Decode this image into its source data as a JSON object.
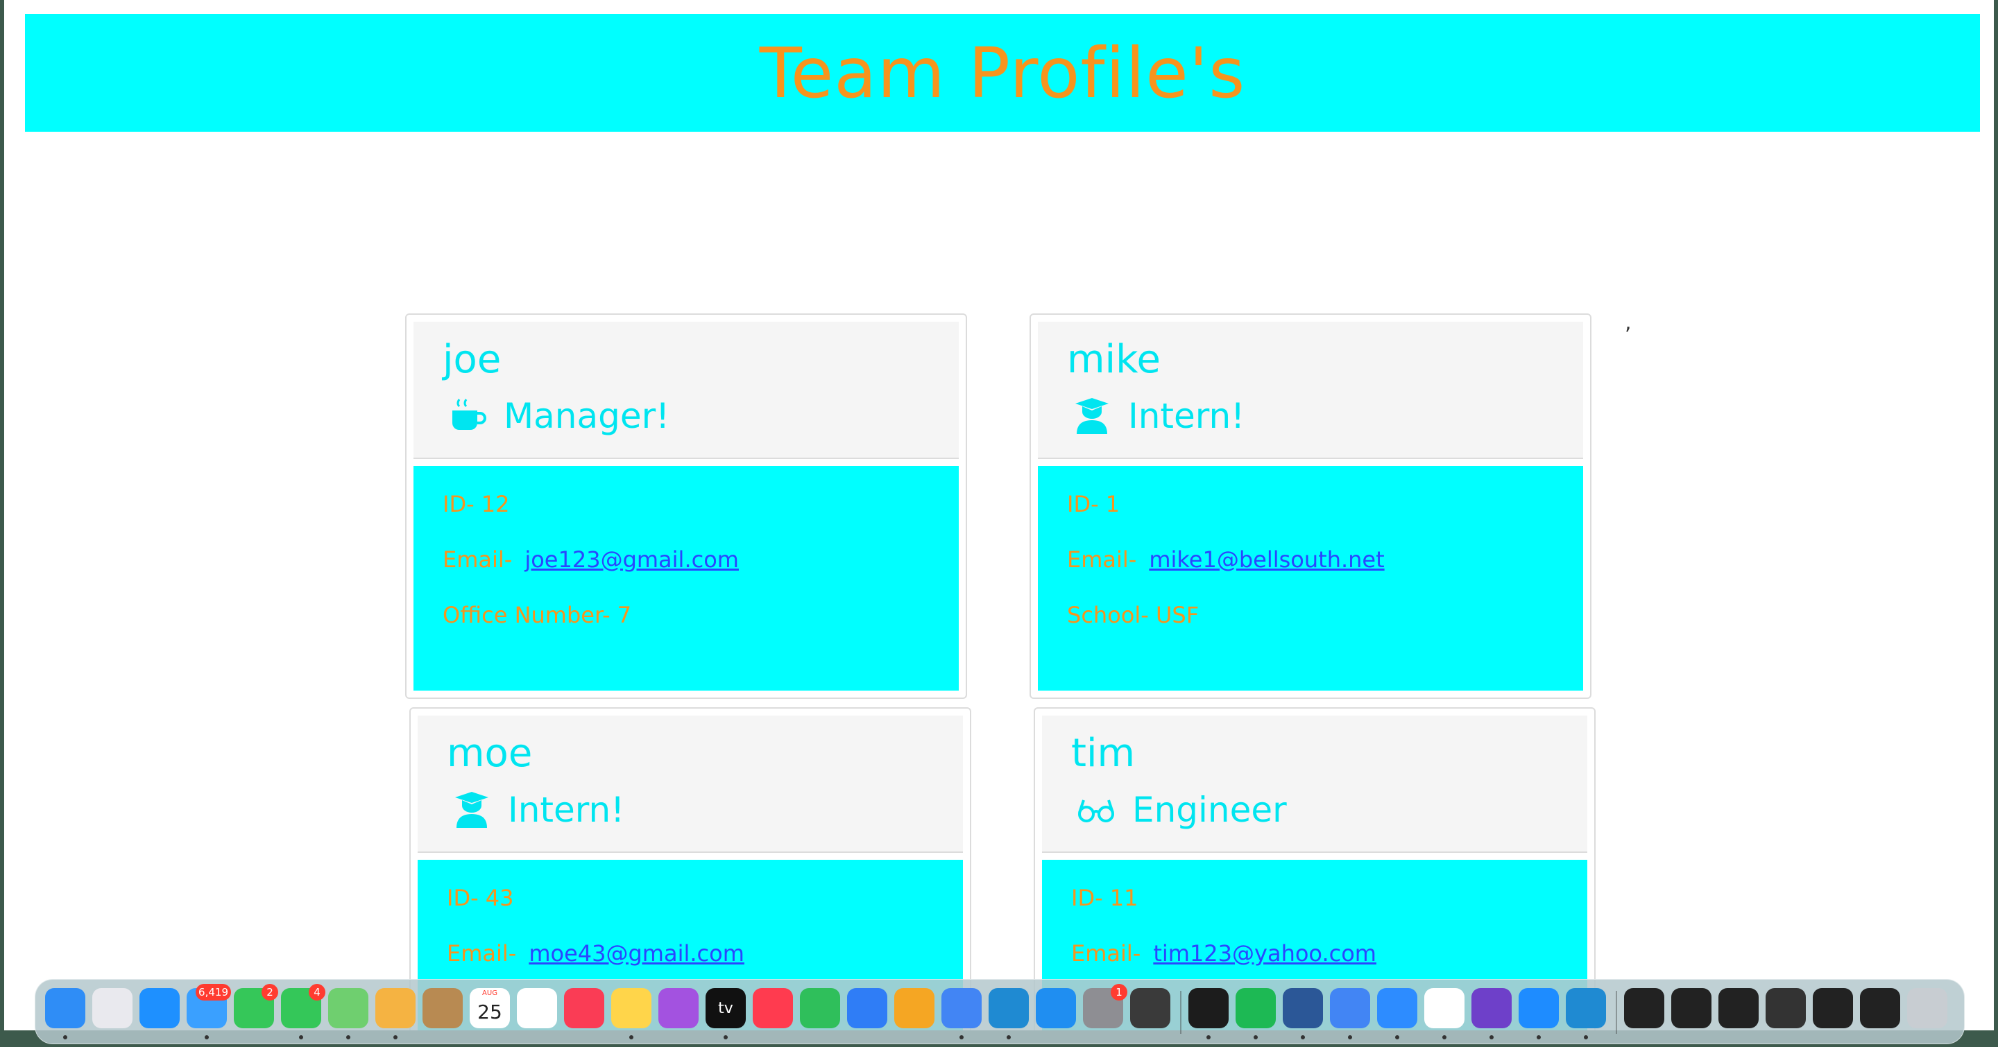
{
  "header": {
    "title": "Team Profile's"
  },
  "stray_text": ",",
  "cards": [
    {
      "name": "joe",
      "role": "Manager!",
      "role_icon": "coffee-mug-icon",
      "id_label": "ID-",
      "id": "12",
      "email_label": "Email-",
      "email": "joe123@gmail.com",
      "extra_label": "Office Number-",
      "extra": "7"
    },
    {
      "name": "mike",
      "role": "Intern!",
      "role_icon": "graduate-icon",
      "id_label": "ID-",
      "id": "1",
      "email_label": "Email-",
      "email": "mike1@bellsouth.net",
      "extra_label": "School-",
      "extra": "USF"
    },
    {
      "name": "moe",
      "role": "Intern!",
      "role_icon": "graduate-icon",
      "id_label": "ID-",
      "id": "43",
      "email_label": "Email-",
      "email": "moe43@gmail.com"
    },
    {
      "name": "tim",
      "role": "Engineer",
      "role_icon": "glasses-icon",
      "id_label": "ID-",
      "id": "11",
      "email_label": "Email-",
      "email": "tim123@yahoo.com"
    }
  ],
  "colors": {
    "accent": "#00ffff",
    "title": "#f7941d",
    "name": "#00e5f0",
    "link": "#2a46ff"
  },
  "dock": {
    "icons": [
      {
        "name": "finder-icon",
        "color": "#2f8df6"
      },
      {
        "name": "launchpad-icon",
        "color": "#e9e9ee"
      },
      {
        "name": "safari-icon",
        "color": "#1e90ff"
      },
      {
        "name": "mail-icon",
        "color": "#3aa0ff",
        "badge": "6,419"
      },
      {
        "name": "facetime-icon",
        "color": "#35c759",
        "badge": "2"
      },
      {
        "name": "messages-icon",
        "color": "#34c759",
        "badge": "4"
      },
      {
        "name": "maps-icon",
        "color": "#6fcf6f"
      },
      {
        "name": "photos-icon",
        "color": "#f5b342"
      },
      {
        "name": "contacts-icon",
        "color": "#b88a52"
      },
      {
        "name": "calendar-icon",
        "color": "#ffffff",
        "label": "25",
        "sub": "AUG"
      },
      {
        "name": "reminders-icon",
        "color": "#ffffff"
      },
      {
        "name": "music-icon",
        "color": "#fa3c55"
      },
      {
        "name": "notes-icon",
        "color": "#ffd54a"
      },
      {
        "name": "podcasts-icon",
        "color": "#a352e0"
      },
      {
        "name": "tv-icon",
        "color": "#111111",
        "label": "tv"
      },
      {
        "name": "news-icon",
        "color": "#ff3b4f"
      },
      {
        "name": "numbers-icon",
        "color": "#2fbf5b"
      },
      {
        "name": "keynote-icon",
        "color": "#2f7df6"
      },
      {
        "name": "pages-icon",
        "color": "#f5a623"
      },
      {
        "name": "chrome-icon",
        "color": "#4285f4"
      },
      {
        "name": "vscode-icon",
        "color": "#1f8ad2"
      },
      {
        "name": "app-store-icon",
        "color": "#1f8ef1"
      },
      {
        "name": "system-preferences-icon",
        "color": "#8e8e93",
        "badge": "1"
      },
      {
        "name": "imovie-icon",
        "color": "#3a3a3a"
      },
      {
        "name": "terminal-icon",
        "color": "#1c1c1c"
      },
      {
        "name": "spotify-icon",
        "color": "#1db954"
      },
      {
        "name": "word-icon",
        "color": "#2b5797"
      },
      {
        "name": "chrome-icon-2",
        "color": "#4285f4"
      },
      {
        "name": "zoom-icon",
        "color": "#2d8cff"
      },
      {
        "name": "slack-icon",
        "color": "#ffffff"
      },
      {
        "name": "github-desktop-icon",
        "color": "#6e40c9"
      },
      {
        "name": "bluetooth-icon",
        "color": "#1e8cff"
      },
      {
        "name": "vscode-icon-2",
        "color": "#1f8ad2"
      },
      {
        "name": "window-thumb-1-icon",
        "color": "#222222"
      },
      {
        "name": "window-thumb-2-icon",
        "color": "#222222"
      },
      {
        "name": "window-thumb-3-icon",
        "color": "#222222"
      },
      {
        "name": "window-thumb-4-icon",
        "color": "#333333"
      },
      {
        "name": "window-thumb-5-icon",
        "color": "#222222"
      },
      {
        "name": "window-thumb-6-icon",
        "color": "#222222"
      },
      {
        "name": "trash-icon",
        "color": "#c8cdd2"
      }
    ]
  }
}
